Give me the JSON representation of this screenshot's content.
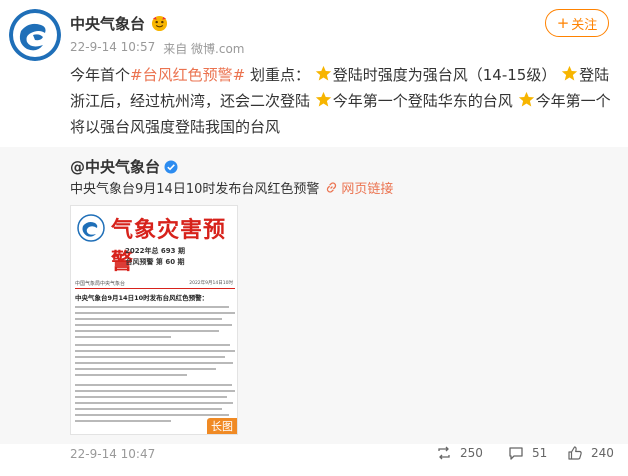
{
  "post": {
    "author": "中央气象台",
    "meta_time": "22-9-14 10:57",
    "meta_source": "来自 微博.com",
    "follow_label": "关注",
    "text_parts": {
      "p1": "今年首个",
      "hashtag": "#台风红色预警#",
      "p2": "划重点：",
      "s1": "登陆时强度为强台风（14-15级）",
      "s2": "登陆浙江后，经过杭州湾，还会二次登陆",
      "s3": "今年第一个登陆华东的台风",
      "s4": "今年第一个将以强台风强度登陆我国的台风"
    }
  },
  "repost": {
    "author": "@中央气象台",
    "text": "中央气象台9月14日10时发布台风红色预警",
    "link_label": "网页链接"
  },
  "image": {
    "title": "气象灾害预警",
    "issue_line1": "2022年总 693 期",
    "issue_line2": "台风预警 第 60 期",
    "org": "中国气象局中央气象台",
    "date": "2022年9月14日10时",
    "headline": "中央气象台9月14日10时发布台风红色预警：",
    "long_tag": "长图"
  },
  "footer": {
    "time": "22-9-14 10:47",
    "reposts": "250",
    "comments": "51",
    "likes": "240"
  },
  "colors": {
    "accent": "#ff8200",
    "hashtag": "#eb7350",
    "repost_bg": "#f7f7f7",
    "warning_red": "#d7221b"
  },
  "icons": {
    "verified": "verified-badge-icon",
    "star": "star-icon",
    "link": "link-icon",
    "repost": "repost-icon",
    "comment": "comment-icon",
    "like": "like-icon"
  }
}
